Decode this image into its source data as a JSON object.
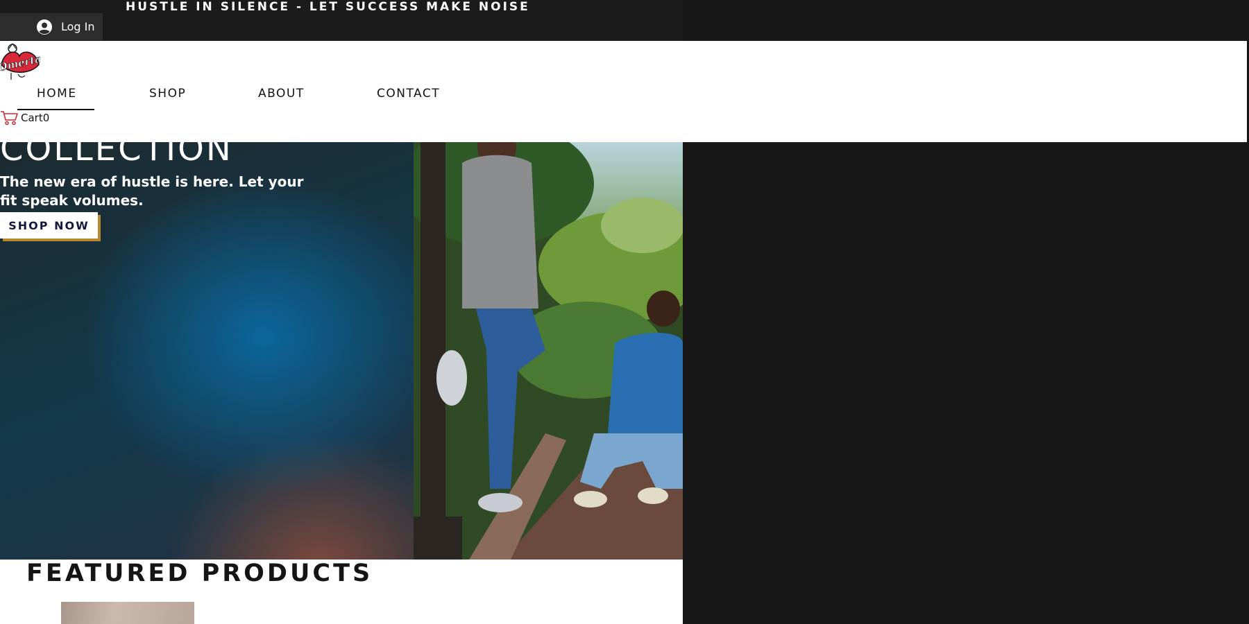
{
  "announcement": {
    "text": "HUSTLE IN SILENCE - LET SUCCESS MAKE NOISE"
  },
  "login": {
    "label": "Log In",
    "icon": "avatar-icon"
  },
  "logo": {
    "text": "Omerta",
    "icon": "omerta-logo"
  },
  "nav": {
    "items": [
      {
        "label": "HOME",
        "active": true
      },
      {
        "label": "SHOP",
        "active": false
      },
      {
        "label": "ABOUT",
        "active": false
      },
      {
        "label": "CONTACT",
        "active": false
      }
    ]
  },
  "cart": {
    "label": "Cart",
    "count": "0",
    "icon": "cart-icon"
  },
  "hero": {
    "title": "COLLECTION",
    "subtitle": "The new era of hustle is here. Let your fit speak volumes.",
    "button_label": "SHOP NOW",
    "photo_icon": "hero-photo"
  },
  "featured": {
    "title": "FEATURED PRODUCTS"
  },
  "colors": {
    "topbar": "#1b1b1b",
    "accent_shadow": "#b8892c",
    "button_text": "#15163a",
    "logo_red": "#d8283a"
  }
}
